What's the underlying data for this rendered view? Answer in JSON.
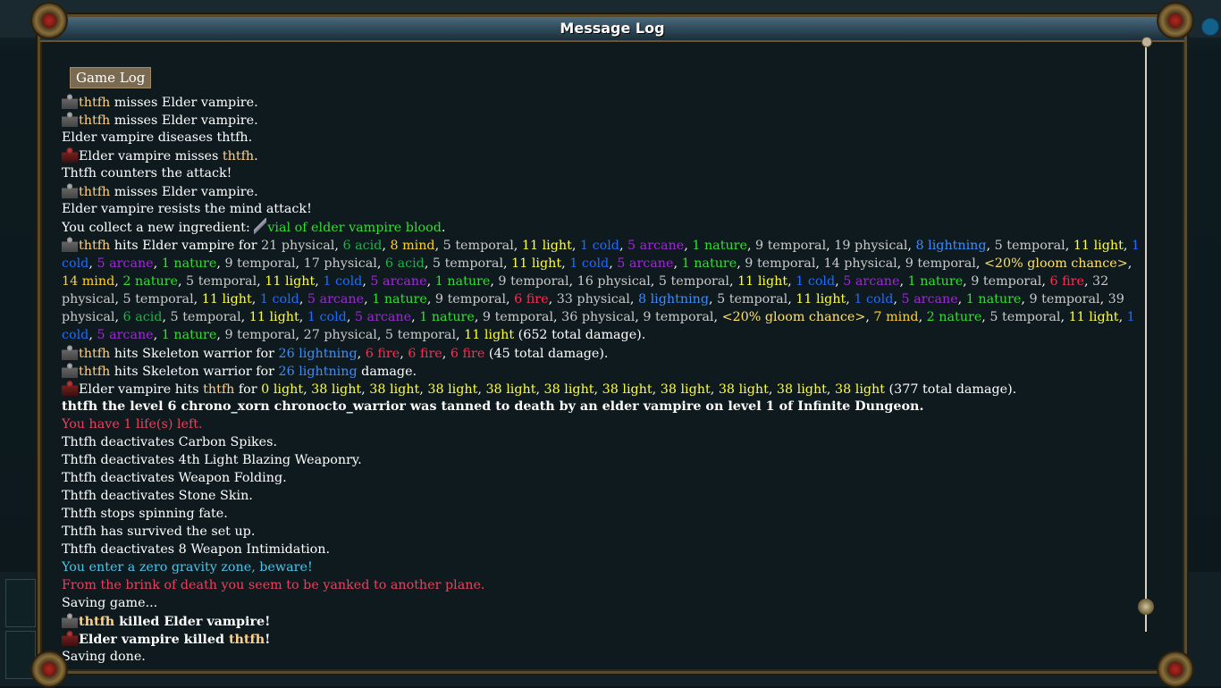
{
  "window": {
    "title": "Message Log"
  },
  "tabs": [
    {
      "label": "Game Log"
    }
  ],
  "log": [
    {
      "icon": "pc",
      "style": "",
      "segments": [
        {
          "t": "thtfh",
          "c": "name"
        },
        {
          "t": " misses Elder vampire.",
          "c": "white"
        }
      ]
    },
    {
      "icon": "pc",
      "style": "",
      "segments": [
        {
          "t": "thtfh",
          "c": "name"
        },
        {
          "t": " misses Elder vampire.",
          "c": "white"
        }
      ]
    },
    {
      "icon": "",
      "style": "",
      "segments": [
        {
          "t": "Elder vampire diseases thtfh.",
          "c": "white"
        }
      ]
    },
    {
      "icon": "vamp",
      "style": "",
      "segments": [
        {
          "t": "Elder vampire misses ",
          "c": "white"
        },
        {
          "t": "thtfh",
          "c": "name"
        },
        {
          "t": ".",
          "c": "white"
        }
      ]
    },
    {
      "icon": "",
      "style": "",
      "segments": [
        {
          "t": "Thtfh counters the attack!",
          "c": "white"
        }
      ]
    },
    {
      "icon": "pc",
      "style": "",
      "segments": [
        {
          "t": "thtfh",
          "c": "name"
        },
        {
          "t": " misses Elder vampire.",
          "c": "white"
        }
      ]
    },
    {
      "icon": "",
      "style": "",
      "segments": [
        {
          "t": "Elder vampire resists the mind attack!",
          "c": "white"
        }
      ]
    },
    {
      "icon": "",
      "style": "",
      "segments": [
        {
          "t": "You collect a new ingredient: ",
          "c": "white"
        },
        {
          "t": "",
          "c": "vialicon"
        },
        {
          "t": "vial of elder vampire blood",
          "c": "item"
        },
        {
          "t": ".",
          "c": "white"
        }
      ]
    },
    {
      "icon": "pc",
      "style": "wrap",
      "segments": [
        {
          "t": "thtfh",
          "c": "name"
        },
        {
          "t": " hits Elder vampire for ",
          "c": "white"
        },
        {
          "t": "21 physical",
          "c": "phys"
        },
        {
          "t": ", ",
          "c": "white"
        },
        {
          "t": "6 acid",
          "c": "acid"
        },
        {
          "t": ", ",
          "c": "white"
        },
        {
          "t": "8 mind",
          "c": "mind"
        },
        {
          "t": ", ",
          "c": "white"
        },
        {
          "t": "5 temporal",
          "c": "temp"
        },
        {
          "t": ", ",
          "c": "white"
        },
        {
          "t": "11 light",
          "c": "light"
        },
        {
          "t": ", ",
          "c": "white"
        },
        {
          "t": "1 cold",
          "c": "cold"
        },
        {
          "t": ", ",
          "c": "white"
        },
        {
          "t": "5 arcane",
          "c": "arcane"
        },
        {
          "t": ", ",
          "c": "white"
        },
        {
          "t": "1 nature",
          "c": "nature"
        },
        {
          "t": ", ",
          "c": "white"
        },
        {
          "t": "9 temporal",
          "c": "temp"
        },
        {
          "t": ", ",
          "c": "white"
        },
        {
          "t": "19 physical",
          "c": "phys"
        },
        {
          "t": ", ",
          "c": "white"
        },
        {
          "t": "8 lightning",
          "c": "lightning"
        },
        {
          "t": ", ",
          "c": "white"
        },
        {
          "t": "5 temporal",
          "c": "temp"
        },
        {
          "t": ", ",
          "c": "white"
        },
        {
          "t": "11 light",
          "c": "light"
        },
        {
          "t": ", ",
          "c": "white"
        },
        {
          "t": "1 cold",
          "c": "cold"
        },
        {
          "t": ", ",
          "c": "white"
        },
        {
          "t": "5 arcane",
          "c": "arcane"
        },
        {
          "t": ", ",
          "c": "white"
        },
        {
          "t": "1 nature",
          "c": "nature"
        },
        {
          "t": ", ",
          "c": "white"
        },
        {
          "t": "9 temporal",
          "c": "temp"
        },
        {
          "t": ", ",
          "c": "white"
        },
        {
          "t": "17 physical",
          "c": "phys"
        },
        {
          "t": ", ",
          "c": "white"
        },
        {
          "t": "6 acid",
          "c": "acid"
        },
        {
          "t": ", ",
          "c": "white"
        },
        {
          "t": "5 temporal",
          "c": "temp"
        },
        {
          "t": ", ",
          "c": "white"
        },
        {
          "t": "11 light",
          "c": "light"
        },
        {
          "t": ", ",
          "c": "white"
        },
        {
          "t": "1 cold",
          "c": "cold"
        },
        {
          "t": ", ",
          "c": "white"
        },
        {
          "t": "5 arcane",
          "c": "arcane"
        },
        {
          "t": ", ",
          "c": "white"
        },
        {
          "t": "1 nature",
          "c": "nature"
        },
        {
          "t": ", ",
          "c": "white"
        },
        {
          "t": "9 temporal",
          "c": "temp"
        },
        {
          "t": ", ",
          "c": "white"
        },
        {
          "t": "14 physical",
          "c": "phys"
        },
        {
          "t": ", ",
          "c": "white"
        },
        {
          "t": "9 temporal",
          "c": "temp"
        },
        {
          "t": ", ",
          "c": "white"
        },
        {
          "t": "<20% gloom chance>",
          "c": "gloom"
        },
        {
          "t": ", ",
          "c": "white"
        },
        {
          "t": "14 mind",
          "c": "mind"
        },
        {
          "t": ", ",
          "c": "white"
        },
        {
          "t": "2 nature",
          "c": "nature"
        },
        {
          "t": ", ",
          "c": "white"
        },
        {
          "t": "5 temporal",
          "c": "temp"
        },
        {
          "t": ", ",
          "c": "white"
        },
        {
          "t": "11 light",
          "c": "light"
        },
        {
          "t": ", ",
          "c": "white"
        },
        {
          "t": "1 cold",
          "c": "cold"
        },
        {
          "t": ", ",
          "c": "white"
        },
        {
          "t": "5 arcane",
          "c": "arcane"
        },
        {
          "t": ", ",
          "c": "white"
        },
        {
          "t": "1 nature",
          "c": "nature"
        },
        {
          "t": ", ",
          "c": "white"
        },
        {
          "t": "9 temporal",
          "c": "temp"
        },
        {
          "t": ", ",
          "c": "white"
        },
        {
          "t": "16 physical",
          "c": "phys"
        },
        {
          "t": ", ",
          "c": "white"
        },
        {
          "t": "5 temporal",
          "c": "temp"
        },
        {
          "t": ", ",
          "c": "white"
        },
        {
          "t": "11 light",
          "c": "light"
        },
        {
          "t": ", ",
          "c": "white"
        },
        {
          "t": "1 cold",
          "c": "cold"
        },
        {
          "t": ", ",
          "c": "white"
        },
        {
          "t": "5 arcane",
          "c": "arcane"
        },
        {
          "t": ", ",
          "c": "white"
        },
        {
          "t": "1 nature",
          "c": "nature"
        },
        {
          "t": ", ",
          "c": "white"
        },
        {
          "t": "9 temporal",
          "c": "temp"
        },
        {
          "t": ", ",
          "c": "white"
        },
        {
          "t": "6 fire",
          "c": "fire"
        },
        {
          "t": ", ",
          "c": "white"
        },
        {
          "t": "32 physical",
          "c": "phys"
        },
        {
          "t": ", ",
          "c": "white"
        },
        {
          "t": "5 temporal",
          "c": "temp"
        },
        {
          "t": ", ",
          "c": "white"
        },
        {
          "t": "11 light",
          "c": "light"
        },
        {
          "t": ", ",
          "c": "white"
        },
        {
          "t": "1 cold",
          "c": "cold"
        },
        {
          "t": ", ",
          "c": "white"
        },
        {
          "t": "5 arcane",
          "c": "arcane"
        },
        {
          "t": ", ",
          "c": "white"
        },
        {
          "t": "1 nature",
          "c": "nature"
        },
        {
          "t": ", ",
          "c": "white"
        },
        {
          "t": "9 temporal",
          "c": "temp"
        },
        {
          "t": ", ",
          "c": "white"
        },
        {
          "t": "6 fire",
          "c": "fire"
        },
        {
          "t": ", ",
          "c": "white"
        },
        {
          "t": "33 physical",
          "c": "phys"
        },
        {
          "t": ", ",
          "c": "white"
        },
        {
          "t": "8 lightning",
          "c": "lightning"
        },
        {
          "t": ", ",
          "c": "white"
        },
        {
          "t": "5 temporal",
          "c": "temp"
        },
        {
          "t": ", ",
          "c": "white"
        },
        {
          "t": "11 light",
          "c": "light"
        },
        {
          "t": ", ",
          "c": "white"
        },
        {
          "t": "1 cold",
          "c": "cold"
        },
        {
          "t": ", ",
          "c": "white"
        },
        {
          "t": "5 arcane",
          "c": "arcane"
        },
        {
          "t": ", ",
          "c": "white"
        },
        {
          "t": "1 nature",
          "c": "nature"
        },
        {
          "t": ", ",
          "c": "white"
        },
        {
          "t": "9 temporal",
          "c": "temp"
        },
        {
          "t": ", ",
          "c": "white"
        },
        {
          "t": "39 physical",
          "c": "phys"
        },
        {
          "t": ", ",
          "c": "white"
        },
        {
          "t": "6 acid",
          "c": "acid"
        },
        {
          "t": ", ",
          "c": "white"
        },
        {
          "t": "5 temporal",
          "c": "temp"
        },
        {
          "t": ", ",
          "c": "white"
        },
        {
          "t": "11 light",
          "c": "light"
        },
        {
          "t": ", ",
          "c": "white"
        },
        {
          "t": "1 cold",
          "c": "cold"
        },
        {
          "t": ", ",
          "c": "white"
        },
        {
          "t": "5 arcane",
          "c": "arcane"
        },
        {
          "t": ", ",
          "c": "white"
        },
        {
          "t": "1 nature",
          "c": "nature"
        },
        {
          "t": ", ",
          "c": "white"
        },
        {
          "t": "9 temporal",
          "c": "temp"
        },
        {
          "t": ", ",
          "c": "white"
        },
        {
          "t": "36 physical",
          "c": "phys"
        },
        {
          "t": ", ",
          "c": "white"
        },
        {
          "t": "9 temporal",
          "c": "temp"
        },
        {
          "t": ", ",
          "c": "white"
        },
        {
          "t": "<20% gloom chance>",
          "c": "gloom"
        },
        {
          "t": ", ",
          "c": "white"
        },
        {
          "t": "7 mind",
          "c": "mind"
        },
        {
          "t": ", ",
          "c": "white"
        },
        {
          "t": "2 nature",
          "c": "nature"
        },
        {
          "t": ", ",
          "c": "white"
        },
        {
          "t": "5 temporal",
          "c": "temp"
        },
        {
          "t": ", ",
          "c": "white"
        },
        {
          "t": "11 light",
          "c": "light"
        },
        {
          "t": ", ",
          "c": "white"
        },
        {
          "t": "1 cold",
          "c": "cold"
        },
        {
          "t": ", ",
          "c": "white"
        },
        {
          "t": "5 arcane",
          "c": "arcane"
        },
        {
          "t": ", ",
          "c": "white"
        },
        {
          "t": "1 nature",
          "c": "nature"
        },
        {
          "t": ", ",
          "c": "white"
        },
        {
          "t": "9 temporal",
          "c": "temp"
        },
        {
          "t": ", ",
          "c": "white"
        },
        {
          "t": "27 physical",
          "c": "phys"
        },
        {
          "t": ", ",
          "c": "white"
        },
        {
          "t": "5 temporal",
          "c": "temp"
        },
        {
          "t": ", ",
          "c": "white"
        },
        {
          "t": "11 light",
          "c": "light"
        },
        {
          "t": " (652 total damage).",
          "c": "white"
        }
      ]
    },
    {
      "icon": "pc",
      "style": "",
      "segments": [
        {
          "t": "thtfh",
          "c": "name"
        },
        {
          "t": " hits Skeleton warrior for ",
          "c": "white"
        },
        {
          "t": "26 lightning",
          "c": "lightning"
        },
        {
          "t": ", ",
          "c": "white"
        },
        {
          "t": "6 fire",
          "c": "fire"
        },
        {
          "t": ", ",
          "c": "white"
        },
        {
          "t": "6 fire",
          "c": "fire"
        },
        {
          "t": ", ",
          "c": "white"
        },
        {
          "t": "6 fire",
          "c": "fire"
        },
        {
          "t": " (45 total damage).",
          "c": "white"
        }
      ]
    },
    {
      "icon": "pc",
      "style": "",
      "segments": [
        {
          "t": "thtfh",
          "c": "name"
        },
        {
          "t": " hits Skeleton warrior for ",
          "c": "white"
        },
        {
          "t": "26 lightning",
          "c": "lightning"
        },
        {
          "t": " damage.",
          "c": "white"
        }
      ]
    },
    {
      "icon": "vamp",
      "style": "",
      "segments": [
        {
          "t": "Elder vampire hits ",
          "c": "white"
        },
        {
          "t": "thtfh",
          "c": "name"
        },
        {
          "t": " for ",
          "c": "white"
        },
        {
          "t": "0 light",
          "c": "light"
        },
        {
          "t": ", ",
          "c": "white"
        },
        {
          "t": "38 light",
          "c": "light"
        },
        {
          "t": ", ",
          "c": "white"
        },
        {
          "t": "38 light",
          "c": "light"
        },
        {
          "t": ", ",
          "c": "white"
        },
        {
          "t": "38 light",
          "c": "light"
        },
        {
          "t": ", ",
          "c": "white"
        },
        {
          "t": "38 light",
          "c": "light"
        },
        {
          "t": ", ",
          "c": "white"
        },
        {
          "t": "38 light",
          "c": "light"
        },
        {
          "t": ", ",
          "c": "white"
        },
        {
          "t": "38 light",
          "c": "light"
        },
        {
          "t": ", ",
          "c": "white"
        },
        {
          "t": "38 light",
          "c": "light"
        },
        {
          "t": ", ",
          "c": "white"
        },
        {
          "t": "38 light",
          "c": "light"
        },
        {
          "t": ", ",
          "c": "white"
        },
        {
          "t": "38 light",
          "c": "light"
        },
        {
          "t": ", ",
          "c": "white"
        },
        {
          "t": "38 light",
          "c": "light"
        },
        {
          "t": " (377 total damage).",
          "c": "white"
        }
      ]
    },
    {
      "icon": "",
      "style": "bold",
      "segments": [
        {
          "t": "thtfh the level 6 chrono_xorn chronocto_warrior was tanned to death by an elder vampire on level 1 of Infinite Dungeon.",
          "c": "white"
        }
      ]
    },
    {
      "icon": "",
      "style": "red",
      "segments": [
        {
          "t": "You have 1 life(s) left.",
          "c": "fire"
        }
      ]
    },
    {
      "icon": "",
      "style": "",
      "segments": [
        {
          "t": "Thtfh deactivates Carbon Spikes.",
          "c": "white"
        }
      ]
    },
    {
      "icon": "",
      "style": "",
      "segments": [
        {
          "t": "Thtfh deactivates 4th Light Blazing Weaponry.",
          "c": "white"
        }
      ]
    },
    {
      "icon": "",
      "style": "",
      "segments": [
        {
          "t": "Thtfh deactivates Weapon Folding.",
          "c": "white"
        }
      ]
    },
    {
      "icon": "",
      "style": "",
      "segments": [
        {
          "t": "Thtfh deactivates Stone Skin.",
          "c": "white"
        }
      ]
    },
    {
      "icon": "",
      "style": "",
      "segments": [
        {
          "t": "Thtfh stops spinning fate.",
          "c": "white"
        }
      ]
    },
    {
      "icon": "",
      "style": "",
      "segments": [
        {
          "t": "Thtfh has survived the set up.",
          "c": "white"
        }
      ]
    },
    {
      "icon": "",
      "style": "",
      "segments": [
        {
          "t": "Thtfh deactivates 8 Weapon Intimidation.",
          "c": "white"
        }
      ]
    },
    {
      "icon": "",
      "style": "blue",
      "segments": [
        {
          "t": "You enter a zero gravity zone, beware!",
          "c": "blue"
        }
      ]
    },
    {
      "icon": "",
      "style": "red",
      "segments": [
        {
          "t": "From the brink of death you seem to be yanked to another plane.",
          "c": "fire"
        }
      ]
    },
    {
      "icon": "",
      "style": "",
      "segments": [
        {
          "t": "Saving game...",
          "c": "white"
        }
      ]
    },
    {
      "icon": "pc",
      "style": "bold",
      "segments": [
        {
          "t": "thtfh",
          "c": "name"
        },
        {
          "t": " killed Elder vampire!",
          "c": "white"
        }
      ]
    },
    {
      "icon": "vamp",
      "style": "bold",
      "segments": [
        {
          "t": "Elder vampire killed ",
          "c": "white"
        },
        {
          "t": "thtfh",
          "c": "name"
        },
        {
          "t": "!",
          "c": "white"
        }
      ]
    },
    {
      "icon": "",
      "style": "",
      "segments": [
        {
          "t": "Saving done.",
          "c": "white"
        }
      ]
    }
  ],
  "colors": {
    "name": "#ffd28a",
    "physical": "#c9c9c9",
    "acid": "#1fb04e",
    "mind": "#ffd028",
    "temporal": "#c9c9c9",
    "light": "#ffff3a",
    "cold": "#1e6cff",
    "arcane": "#9a2bd0",
    "nature": "#33dd33",
    "lightning": "#3b8dff",
    "fire": "#ff2b50",
    "gloom": "#ffe16a",
    "zone": "#4cc3e8",
    "frame": "#5b4a2a"
  },
  "icons": {
    "pc": "player-portrait-icon",
    "vamp": "elder-vampire-portrait-icon",
    "vial": "vial-icon"
  }
}
